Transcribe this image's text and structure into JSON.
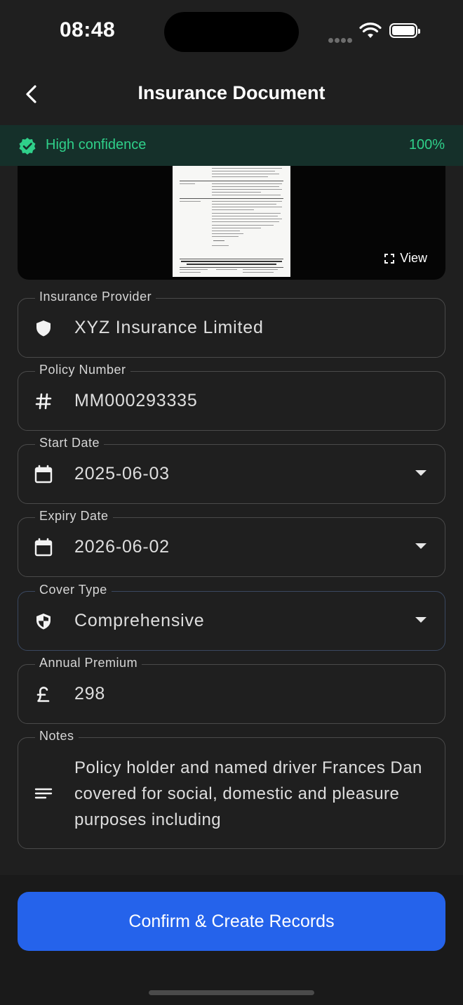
{
  "status": {
    "time": "08:48"
  },
  "header": {
    "title": "Insurance Document"
  },
  "confidence": {
    "label": "High confidence",
    "percent": "100%",
    "color": "#2fd08a"
  },
  "preview": {
    "view_label": "View"
  },
  "fields": {
    "provider": {
      "label": "Insurance Provider",
      "value": "XYZ Insurance Limited",
      "icon": "shield-icon"
    },
    "policy": {
      "label": "Policy Number",
      "value": "MM000293335",
      "icon": "hash-icon"
    },
    "start": {
      "label": "Start Date",
      "value": "2025-06-03",
      "icon": "calendar-icon"
    },
    "expiry": {
      "label": "Expiry Date",
      "value": "2026-06-02",
      "icon": "calendar-icon"
    },
    "cover": {
      "label": "Cover Type",
      "value": "Comprehensive",
      "icon": "shield-half-icon"
    },
    "premium": {
      "label": "Annual Premium",
      "value": "298",
      "icon": "pound-icon"
    },
    "notes": {
      "label": "Notes",
      "value": "Policy holder and named driver Frances Dan covered for social, domestic and pleasure purposes including",
      "icon": "notes-icon"
    }
  },
  "actions": {
    "confirm_label": "Confirm & Create Records",
    "accent": "#2563eb"
  }
}
